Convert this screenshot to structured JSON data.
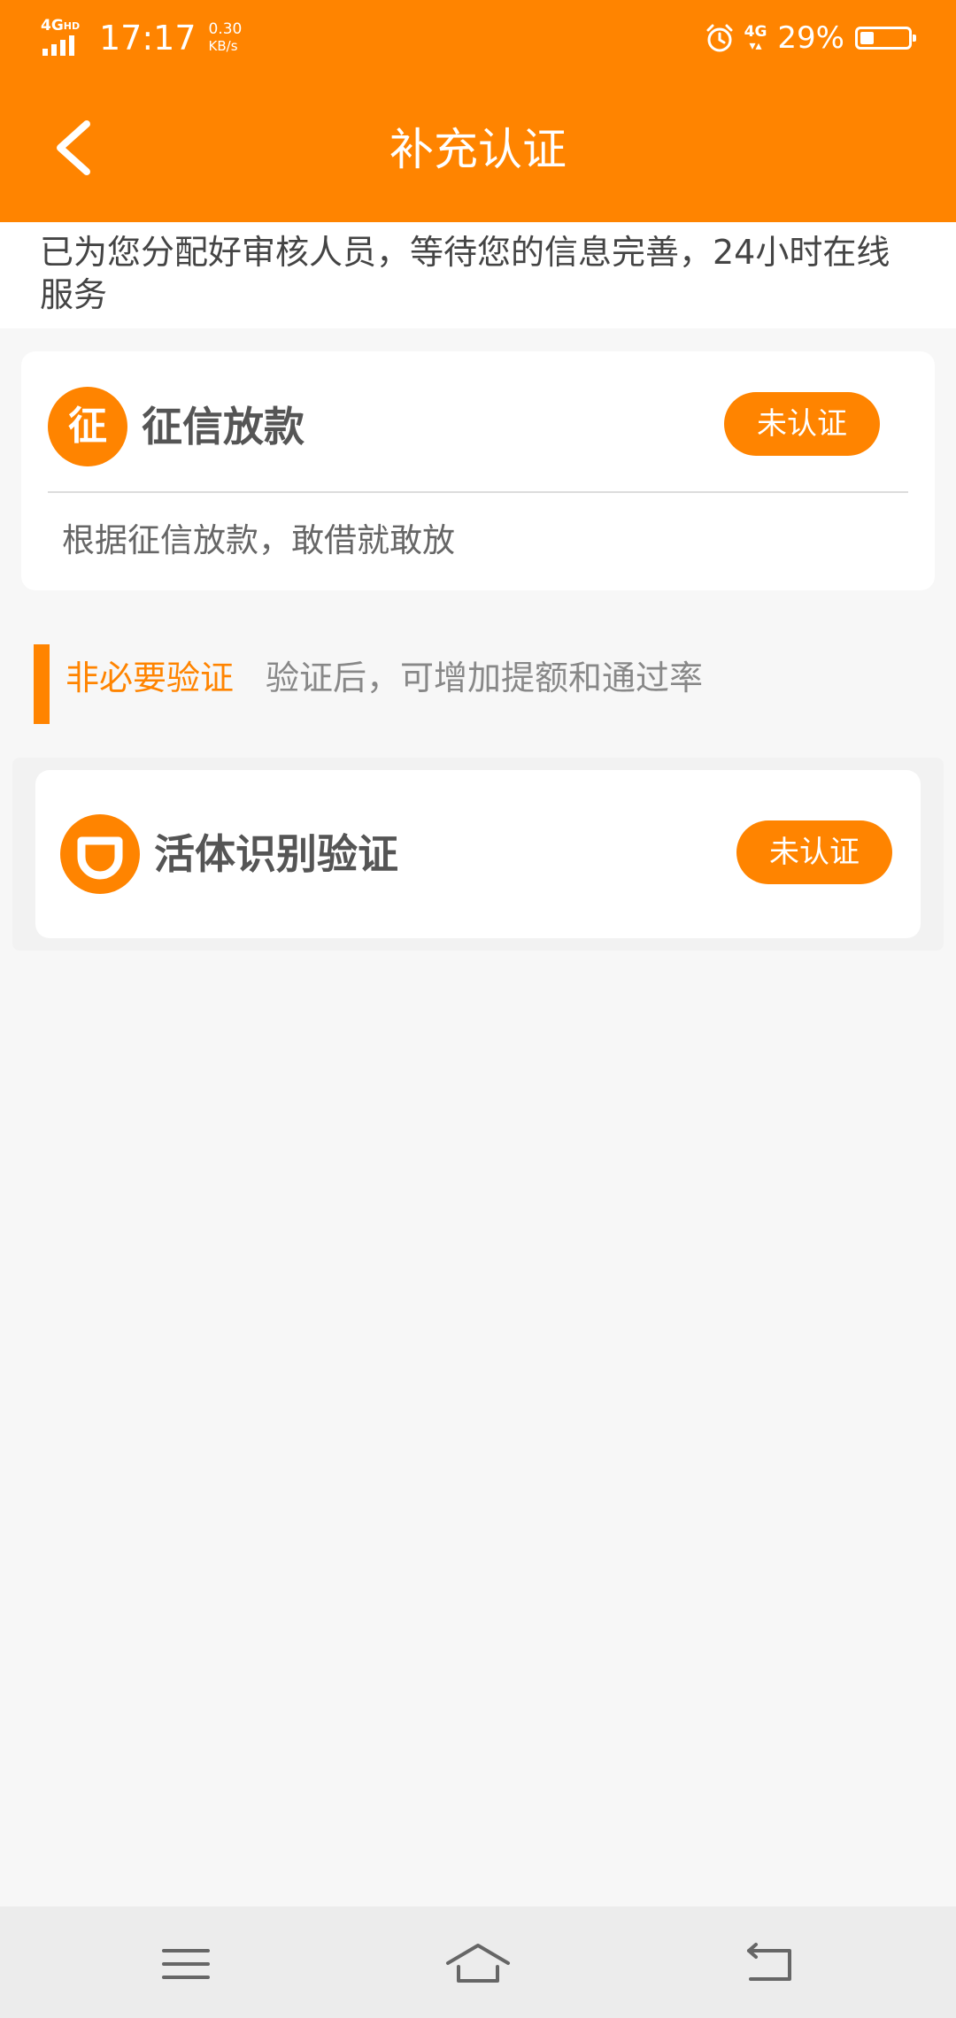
{
  "status_bar": {
    "network_type": "4G",
    "network_hd": "HD",
    "time": "17:17",
    "speed_value": "0.30",
    "speed_unit": "KB/s",
    "network_type_secondary": "4G",
    "battery_percent": "29%",
    "battery_level": 0.29
  },
  "header": {
    "title": "补充认证"
  },
  "notice": {
    "text": "已为您分配好审核人员，等待您的信息完善，24小时在线服务"
  },
  "credit_card": {
    "badge": "征",
    "title": "征信放款",
    "status_label": "未认证",
    "description": "根据征信放款，敢借就敢放"
  },
  "optional_section": {
    "title": "非必要验证",
    "description": "验证后，可增加提额和通过率"
  },
  "liveness_card": {
    "title": "活体识别验证",
    "status_label": "未认证"
  },
  "colors": {
    "accent": "#ff8400",
    "background": "#f7f7f7",
    "card": "#ffffff",
    "nav_bar": "#ececec"
  }
}
